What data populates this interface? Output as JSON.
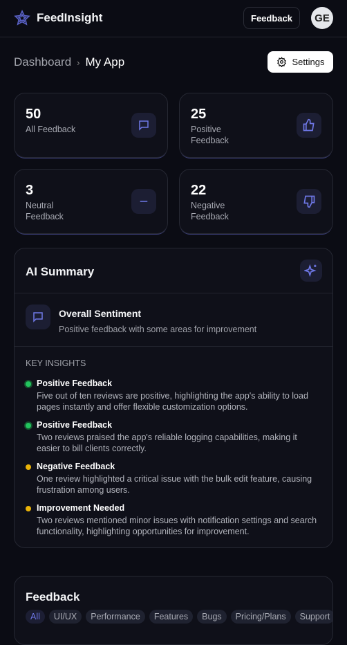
{
  "header": {
    "brand": "FeedInsight",
    "feedback_button": "Feedback",
    "avatar_initials": "GE"
  },
  "breadcrumb": {
    "parent": "Dashboard",
    "current": "My App"
  },
  "settings_label": "Settings",
  "stats": [
    {
      "value": "50",
      "label": "All Feedback",
      "icon": "message-icon"
    },
    {
      "value": "25",
      "label": "Positive Feedback",
      "icon": "thumbs-up-icon"
    },
    {
      "value": "3",
      "label": "Neutral Feedback",
      "icon": "minus-icon"
    },
    {
      "value": "22",
      "label": "Negative Feedback",
      "icon": "thumbs-down-icon"
    }
  ],
  "ai_summary": {
    "title": "AI Summary",
    "sentiment_title": "Overall Sentiment",
    "sentiment_text": "Positive feedback with some areas for improvement",
    "insights_label": "KEY INSIGHTS",
    "insights": [
      {
        "title": "Positive Feedback",
        "text": "Five out of ten reviews are positive, highlighting the app's ability to load pages instantly and offer flexible customization options.",
        "color": "#22c55e"
      },
      {
        "title": "Positive Feedback",
        "text": "Two reviews praised the app's reliable logging capabilities, making it easier to bill clients correctly.",
        "color": "#22c55e"
      },
      {
        "title": "Negative Feedback",
        "text": "One review highlighted a critical issue with the bulk edit feature, causing frustration among users.",
        "color": "#eab308"
      },
      {
        "title": "Improvement Needed",
        "text": "Two reviews mentioned minor issues with notification settings and search functionality, highlighting opportunities for improvement.",
        "color": "#eab308"
      }
    ]
  },
  "feedback": {
    "title": "Feedback",
    "filters": [
      "All",
      "UI/UX",
      "Performance",
      "Features",
      "Bugs",
      "Pricing/Plans",
      "Support"
    ],
    "active_filter": "All"
  },
  "colors": {
    "accent": "#6f78e8",
    "background": "#0b0c14"
  }
}
